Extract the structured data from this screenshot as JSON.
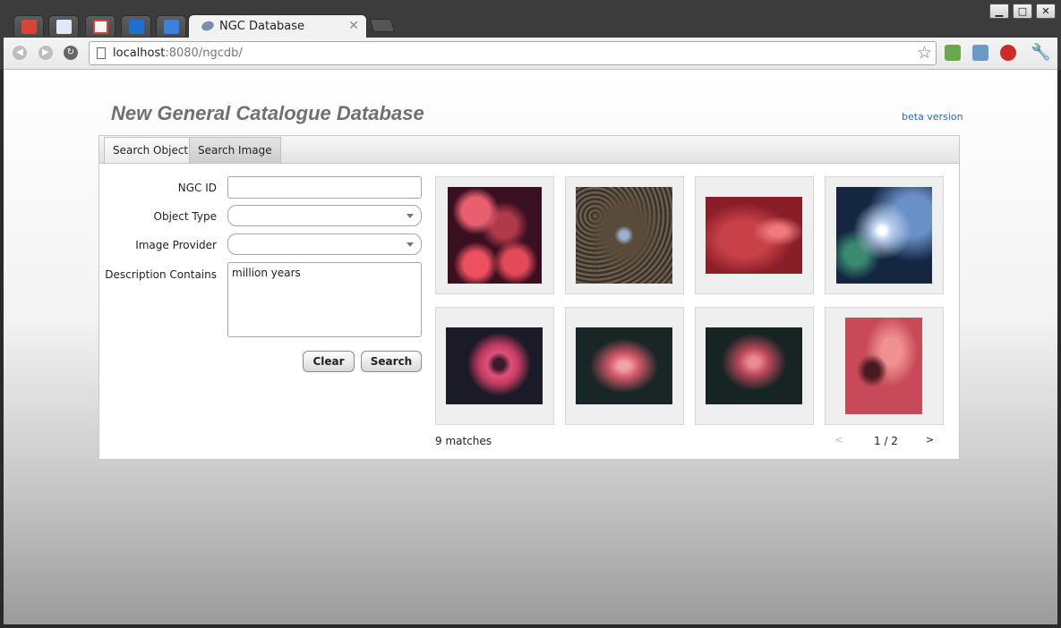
{
  "browser": {
    "pinned_tabs": [
      {
        "name": "google-plus-tab",
        "icon": "google-plus-icon",
        "color": "#d14836"
      },
      {
        "name": "imo-tab",
        "icon": "imo-icon",
        "color": "#5a8fd8"
      },
      {
        "name": "gmail-tab",
        "icon": "gmail-icon",
        "color": "#d14836"
      },
      {
        "name": "calendar-tab",
        "icon": "calendar-icon",
        "color": "#1f6fd1"
      },
      {
        "name": "google-apps-tab",
        "icon": "google-apps-icon",
        "color": "#3b7fe0"
      }
    ],
    "active_tab": {
      "title": "NGC Database",
      "close": "✕"
    },
    "window_controls": {
      "minimize": "▁",
      "maximize": "□",
      "close": "✕"
    },
    "address": {
      "host": "localhost",
      "rest": ":8080/ngcdb/"
    }
  },
  "page": {
    "title": "New General Catalogue Database",
    "beta_label": "beta version",
    "tabs": [
      {
        "label": "Search Object",
        "active": false
      },
      {
        "label": "Search Image",
        "active": true
      }
    ],
    "form": {
      "ngc_id_label": "NGC ID",
      "ngc_id_value": "",
      "object_type_label": "Object Type",
      "object_type_value": "",
      "image_provider_label": "Image Provider",
      "image_provider_value": "",
      "description_label": "Description Contains",
      "description_value": "million years",
      "clear_label": "Clear",
      "search_label": "Search"
    },
    "results": {
      "thumbnails": [
        {
          "name": "cats-paw-nebula-thumb",
          "colors": [
            "#e04a5a",
            "#3a1020"
          ]
        },
        {
          "name": "starfield-nebula-thumb",
          "colors": [
            "#8a7a6a",
            "#2a2420"
          ]
        },
        {
          "name": "lagoon-nebula-thumb",
          "colors": [
            "#d04a50",
            "#6a1a20"
          ]
        },
        {
          "name": "orion-nebula-thumb",
          "colors": [
            "#a8c0e8",
            "#1a2a4a"
          ]
        },
        {
          "name": "rosette-nebula-thumb",
          "colors": [
            "#e0507a",
            "#1a1a2a"
          ]
        },
        {
          "name": "eagle-nebula-thumb",
          "colors": [
            "#e06070",
            "#1a2a2a"
          ]
        },
        {
          "name": "eagle-nebula-2-thumb",
          "colors": [
            "#d05868",
            "#1a2a2a"
          ]
        },
        {
          "name": "pillars-nebula-thumb",
          "colors": [
            "#e07070",
            "#5a1a20"
          ]
        }
      ],
      "matches_text": "9 matches",
      "prev": "<",
      "page_indicator": "1 / 2",
      "next": ">"
    }
  }
}
